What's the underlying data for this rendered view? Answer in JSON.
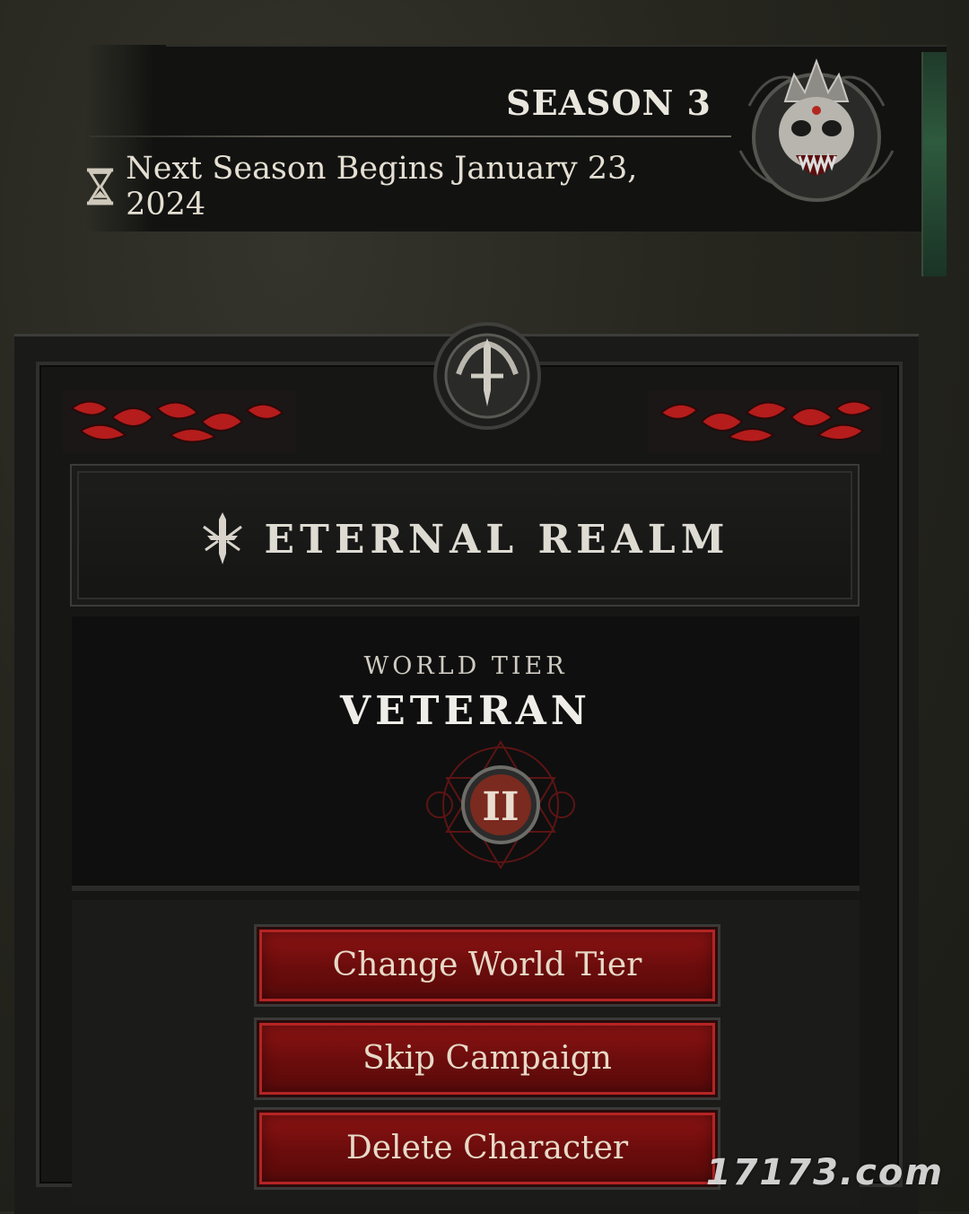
{
  "season": {
    "title": "SEASON 3",
    "next_season_text": "Next Season Begins January 23, 2024",
    "icons": [
      "hourglass-icon",
      "season-skull-icon"
    ]
  },
  "realm": {
    "title": "ETERNAL REALM",
    "icon": "sword-emblem-icon"
  },
  "world_tier": {
    "label": "WORLD TIER",
    "name": "VETERAN",
    "numeral": "II"
  },
  "buttons": {
    "change_world_tier": "Change World Tier",
    "skip_campaign": "Skip Campaign",
    "delete_character": "Delete Character"
  },
  "watermark": "17173.com",
  "colors": {
    "button_red": "#8e1414",
    "panel_dark": "#161615",
    "text_light": "#e7d9c7",
    "banner_green": "#2e5a3e"
  }
}
